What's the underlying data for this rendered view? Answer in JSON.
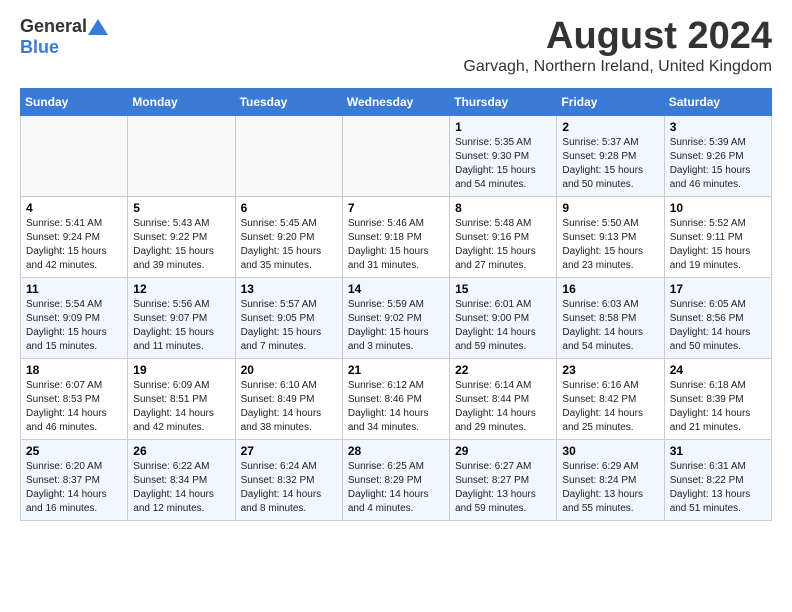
{
  "header": {
    "logo_general": "General",
    "logo_blue": "Blue",
    "title": "August 2024",
    "location": "Garvagh, Northern Ireland, United Kingdom"
  },
  "days_of_week": [
    "Sunday",
    "Monday",
    "Tuesday",
    "Wednesday",
    "Thursday",
    "Friday",
    "Saturday"
  ],
  "weeks": [
    [
      {
        "day": "",
        "info": ""
      },
      {
        "day": "",
        "info": ""
      },
      {
        "day": "",
        "info": ""
      },
      {
        "day": "",
        "info": ""
      },
      {
        "day": "1",
        "info": "Sunrise: 5:35 AM\nSunset: 9:30 PM\nDaylight: 15 hours\nand 54 minutes."
      },
      {
        "day": "2",
        "info": "Sunrise: 5:37 AM\nSunset: 9:28 PM\nDaylight: 15 hours\nand 50 minutes."
      },
      {
        "day": "3",
        "info": "Sunrise: 5:39 AM\nSunset: 9:26 PM\nDaylight: 15 hours\nand 46 minutes."
      }
    ],
    [
      {
        "day": "4",
        "info": "Sunrise: 5:41 AM\nSunset: 9:24 PM\nDaylight: 15 hours\nand 42 minutes."
      },
      {
        "day": "5",
        "info": "Sunrise: 5:43 AM\nSunset: 9:22 PM\nDaylight: 15 hours\nand 39 minutes."
      },
      {
        "day": "6",
        "info": "Sunrise: 5:45 AM\nSunset: 9:20 PM\nDaylight: 15 hours\nand 35 minutes."
      },
      {
        "day": "7",
        "info": "Sunrise: 5:46 AM\nSunset: 9:18 PM\nDaylight: 15 hours\nand 31 minutes."
      },
      {
        "day": "8",
        "info": "Sunrise: 5:48 AM\nSunset: 9:16 PM\nDaylight: 15 hours\nand 27 minutes."
      },
      {
        "day": "9",
        "info": "Sunrise: 5:50 AM\nSunset: 9:13 PM\nDaylight: 15 hours\nand 23 minutes."
      },
      {
        "day": "10",
        "info": "Sunrise: 5:52 AM\nSunset: 9:11 PM\nDaylight: 15 hours\nand 19 minutes."
      }
    ],
    [
      {
        "day": "11",
        "info": "Sunrise: 5:54 AM\nSunset: 9:09 PM\nDaylight: 15 hours\nand 15 minutes."
      },
      {
        "day": "12",
        "info": "Sunrise: 5:56 AM\nSunset: 9:07 PM\nDaylight: 15 hours\nand 11 minutes."
      },
      {
        "day": "13",
        "info": "Sunrise: 5:57 AM\nSunset: 9:05 PM\nDaylight: 15 hours\nand 7 minutes."
      },
      {
        "day": "14",
        "info": "Sunrise: 5:59 AM\nSunset: 9:02 PM\nDaylight: 15 hours\nand 3 minutes."
      },
      {
        "day": "15",
        "info": "Sunrise: 6:01 AM\nSunset: 9:00 PM\nDaylight: 14 hours\nand 59 minutes."
      },
      {
        "day": "16",
        "info": "Sunrise: 6:03 AM\nSunset: 8:58 PM\nDaylight: 14 hours\nand 54 minutes."
      },
      {
        "day": "17",
        "info": "Sunrise: 6:05 AM\nSunset: 8:56 PM\nDaylight: 14 hours\nand 50 minutes."
      }
    ],
    [
      {
        "day": "18",
        "info": "Sunrise: 6:07 AM\nSunset: 8:53 PM\nDaylight: 14 hours\nand 46 minutes."
      },
      {
        "day": "19",
        "info": "Sunrise: 6:09 AM\nSunset: 8:51 PM\nDaylight: 14 hours\nand 42 minutes."
      },
      {
        "day": "20",
        "info": "Sunrise: 6:10 AM\nSunset: 8:49 PM\nDaylight: 14 hours\nand 38 minutes."
      },
      {
        "day": "21",
        "info": "Sunrise: 6:12 AM\nSunset: 8:46 PM\nDaylight: 14 hours\nand 34 minutes."
      },
      {
        "day": "22",
        "info": "Sunrise: 6:14 AM\nSunset: 8:44 PM\nDaylight: 14 hours\nand 29 minutes."
      },
      {
        "day": "23",
        "info": "Sunrise: 6:16 AM\nSunset: 8:42 PM\nDaylight: 14 hours\nand 25 minutes."
      },
      {
        "day": "24",
        "info": "Sunrise: 6:18 AM\nSunset: 8:39 PM\nDaylight: 14 hours\nand 21 minutes."
      }
    ],
    [
      {
        "day": "25",
        "info": "Sunrise: 6:20 AM\nSunset: 8:37 PM\nDaylight: 14 hours\nand 16 minutes."
      },
      {
        "day": "26",
        "info": "Sunrise: 6:22 AM\nSunset: 8:34 PM\nDaylight: 14 hours\nand 12 minutes."
      },
      {
        "day": "27",
        "info": "Sunrise: 6:24 AM\nSunset: 8:32 PM\nDaylight: 14 hours\nand 8 minutes."
      },
      {
        "day": "28",
        "info": "Sunrise: 6:25 AM\nSunset: 8:29 PM\nDaylight: 14 hours\nand 4 minutes."
      },
      {
        "day": "29",
        "info": "Sunrise: 6:27 AM\nSunset: 8:27 PM\nDaylight: 13 hours\nand 59 minutes."
      },
      {
        "day": "30",
        "info": "Sunrise: 6:29 AM\nSunset: 8:24 PM\nDaylight: 13 hours\nand 55 minutes."
      },
      {
        "day": "31",
        "info": "Sunrise: 6:31 AM\nSunset: 8:22 PM\nDaylight: 13 hours\nand 51 minutes."
      }
    ]
  ]
}
